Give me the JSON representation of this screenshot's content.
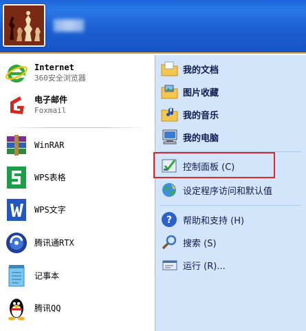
{
  "header": {
    "username": ""
  },
  "left_menu": {
    "pinned": [
      {
        "title": "Internet",
        "subtitle": "360安全浏览器",
        "icon": "ie-browser-icon"
      },
      {
        "title": "电子邮件",
        "subtitle": "Foxmail",
        "icon": "foxmail-icon"
      }
    ],
    "programs": [
      {
        "label": "WinRAR",
        "icon": "winrar-icon"
      },
      {
        "label": "WPS表格",
        "icon": "wps-spreadsheet-icon"
      },
      {
        "label": "WPS文字",
        "icon": "wps-writer-icon"
      },
      {
        "label": "腾讯通RTX",
        "icon": "rtx-icon"
      },
      {
        "label": "记事本",
        "icon": "notepad-icon"
      },
      {
        "label": "腾讯QQ",
        "icon": "qq-icon"
      }
    ]
  },
  "right_menu": {
    "places": [
      {
        "label": "我的文档",
        "icon": "my-documents-icon"
      },
      {
        "label": "图片收藏",
        "icon": "my-pictures-icon"
      },
      {
        "label": "我的音乐",
        "icon": "my-music-icon"
      },
      {
        "label": "我的电脑",
        "icon": "my-computer-icon"
      }
    ],
    "settings": [
      {
        "label": "控制面板 (C)",
        "icon": "control-panel-icon",
        "highlighted": true
      },
      {
        "label": "设定程序访问和默认值",
        "icon": "program-defaults-icon"
      }
    ],
    "help": [
      {
        "label": "帮助和支持 (H)",
        "icon": "help-icon"
      },
      {
        "label": "搜索 (S)",
        "icon": "search-icon"
      },
      {
        "label": "运行 (R)...",
        "icon": "run-icon"
      }
    ]
  },
  "colors": {
    "header_blue": "#1c5fd3",
    "right_pane_bg": "#d3e5fa",
    "highlight_border": "#e02525",
    "header_orange_line": "#e49c3c"
  }
}
